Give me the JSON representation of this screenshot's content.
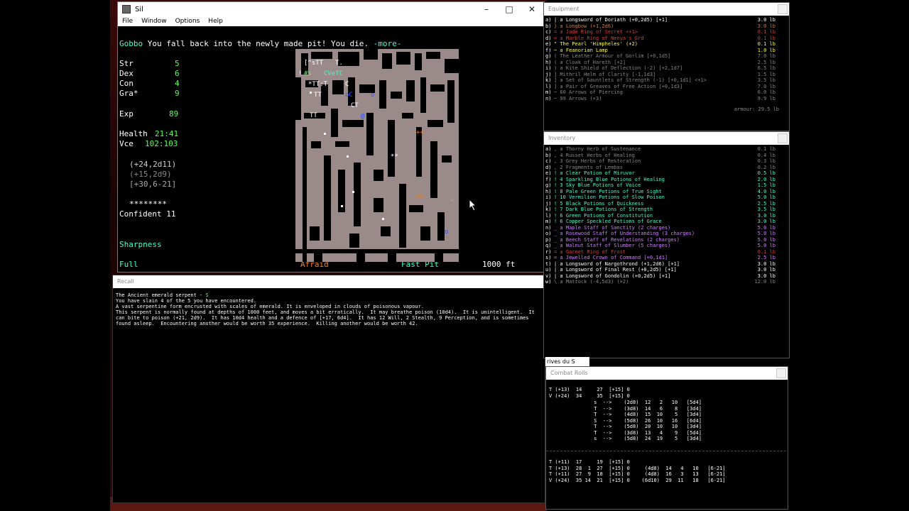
{
  "window": {
    "title": "Sil",
    "menu": [
      "File",
      "Window",
      "Options",
      "Help"
    ]
  },
  "message": {
    "text": "You fall back into the newly made pit! You die.",
    "more": "-more-"
  },
  "character": {
    "name": "Gobbo",
    "stats": [
      {
        "label": "Str",
        "value": "5"
      },
      {
        "label": "Dex",
        "value": "6"
      },
      {
        "label": "Con",
        "value": "4"
      },
      {
        "label": "Gra*",
        "value": "9"
      }
    ],
    "exp_label": "Exp",
    "exp_value": "89",
    "health_label": "Health",
    "health_value": "21:41",
    "voice_label": "Vce",
    "voice_value": "102:103",
    "melee1": "(+24,2d11)",
    "melee2": "(+15,2d9)",
    "armour": "[+30,6-21]",
    "stars": "********",
    "confidence": "Confident 11",
    "sharpness": "Sharpness",
    "status_full": "Full",
    "status_afraid": "Afraid",
    "status_fastpit": "Fast Pit",
    "depth": "1000 ft"
  },
  "equipment": {
    "title": "Equipment",
    "items": [
      {
        "slot": "a)",
        "text": "| a Longsword of Doriath (+0,2d5) [+1]",
        "weight": "3.0 lb",
        "color": "#ffffff"
      },
      {
        "slot": "b)",
        "text": "} a Longbow (+1,2d6)",
        "weight": "3.0 lb",
        "color": "#c08050"
      },
      {
        "slot": "c)",
        "text": "= a Jade Ring of Secret <+1>",
        "weight": "0.1 lb",
        "color": "#d04040"
      },
      {
        "slot": "d)",
        "text": "= a Marble Ring of Nenya's Grd",
        "weight": "0.1 lb",
        "color": "#d04040"
      },
      {
        "slot": "e)",
        "text": "\" The Pearl 'Himpheles' (+2)",
        "weight": "0.1 lb",
        "color": "#ffff40"
      },
      {
        "slot": "f)",
        "text": "~ a Feanorian Lamp",
        "weight": "1.0 lb",
        "color": "#ffff40"
      },
      {
        "slot": "g)",
        "text": "( The Leather Armour of Gorlim [+0,1d5]",
        "weight": "7.0 lb",
        "color": "#888888"
      },
      {
        "slot": "h)",
        "text": "( a Cloak of Hareth [+2]",
        "weight": "2.5 lb",
        "color": "#888888"
      },
      {
        "slot": "i)",
        "text": ") a Kite Shield of Deflection (-2) [+2,1d7]",
        "weight": "6.5 lb",
        "color": "#888888"
      },
      {
        "slot": "j)",
        "text": "] Mithril Helm of Clarity [-1,1d3]",
        "weight": "1.5 lb",
        "color": "#888888"
      },
      {
        "slot": "k)",
        "text": "] a Set of Gauntlets of Strength (-1) [+0,1d1] <+1>",
        "weight": "3.5 lb",
        "color": "#888888"
      },
      {
        "slot": "l)",
        "text": "] a Pair of Greaves of Free Action [+0,1d3]",
        "weight": "7.0 lb",
        "color": "#888888"
      },
      {
        "slot": "m)",
        "text": "~ 60 Arrows of Piercing",
        "weight": "6.0 lb",
        "color": "#888888"
      },
      {
        "slot": "n)",
        "text": "~ 99 Arrows (+3)",
        "weight": "9.9 lb",
        "color": "#888888"
      }
    ],
    "total": "armour: 29.5 lb"
  },
  "inventory": {
    "title": "Inventory",
    "items": [
      {
        "slot": "a)",
        "text": ", a Thorny Herb of Sustenance",
        "weight": "0.1 lb",
        "color": "#888888"
      },
      {
        "slot": "b)",
        "text": ", 4 Russet Herbs of Healing",
        "weight": "0.4 lb",
        "color": "#888888"
      },
      {
        "slot": "c)",
        "text": ", 3 Grey Herbs of Restoration",
        "weight": "0.3 lb",
        "color": "#888888"
      },
      {
        "slot": "d)",
        "text": ", 2 Fragments of Lembas",
        "weight": "0.2 lb",
        "color": "#888888"
      },
      {
        "slot": "e)",
        "text": "! a Clear Potion of Miruvor",
        "weight": "0.5 lb",
        "color": "#40ffd0"
      },
      {
        "slot": "f)",
        "text": "! 4 Sparkling Blue Potions of Healing",
        "weight": "2.0 lb",
        "color": "#40ffd0"
      },
      {
        "slot": "g)",
        "text": "! 3 Sky Blue Potions of Voice",
        "weight": "1.5 lb",
        "color": "#40ffd0"
      },
      {
        "slot": "h)",
        "text": "! 8 Pale Green Potions of True Sight",
        "weight": "4.0 lb",
        "color": "#40ffd0"
      },
      {
        "slot": "i)",
        "text": "! 10 Vermilion Potions of Slow Poison",
        "weight": "5.0 lb",
        "color": "#40ffd0"
      },
      {
        "slot": "j)",
        "text": "! 5 Black Potions of Quickness",
        "weight": "2.5 lb",
        "color": "#40ffd0"
      },
      {
        "slot": "k)",
        "text": "! 7 Dark Blue Potions of Strength",
        "weight": "3.5 lb",
        "color": "#40ffd0"
      },
      {
        "slot": "l)",
        "text": "! 6 Green Potions of Constitution",
        "weight": "3.0 lb",
        "color": "#40ffd0"
      },
      {
        "slot": "m)",
        "text": "! 6 Copper Speckled Potions of Grace",
        "weight": "3.0 lb",
        "color": "#40ffd0"
      },
      {
        "slot": "n)",
        "text": "_ a Maple Staff of Sanctity (2 charges)",
        "weight": "5.0 lb",
        "color": "#d080ff"
      },
      {
        "slot": "o)",
        "text": "_ a Rosewood Staff of Understanding (3 charges)",
        "weight": "5.0 lb",
        "color": "#d080ff"
      },
      {
        "slot": "p)",
        "text": "_ a Beech Staff of Revelations (2 charges)",
        "weight": "5.0 lb",
        "color": "#d080ff"
      },
      {
        "slot": "q)",
        "text": "_ a Walnut Staff of Slumber (5 charges)",
        "weight": "5.0 lb",
        "color": "#d080ff"
      },
      {
        "slot": "r)",
        "text": "= a Garnet Ring of Frost",
        "weight": "0.1 lb",
        "color": "#d04040"
      },
      {
        "slot": "s)",
        "text": "= a Jewelled Crown of Command [+0,1d1]",
        "weight": "2.5 lb",
        "color": "#d080ff"
      },
      {
        "slot": "t)",
        "text": "| a Longsword of Nargothrond (+1,2d6) [+1]",
        "weight": "3.0 lb",
        "color": "#ffffff"
      },
      {
        "slot": "u)",
        "text": "| a Longsword of Final Rest (+0,2d5) [+1]",
        "weight": "3.0 lb",
        "color": "#ffffff"
      },
      {
        "slot": "v)",
        "text": "| a Longsword of Gondolin (+0,2d5) [+1]",
        "weight": "3.0 lb",
        "color": "#ffffff"
      },
      {
        "slot": "w)",
        "text": "\\ a Mattock (-4,5d3) (+2)",
        "weight": "12.0 lb",
        "color": "#888888"
      }
    ]
  },
  "recall": {
    "title": "Recall",
    "heading": "The Ancient emerald serpent",
    "symbol": "S",
    "lines": [
      "You have slain 4 of the 5 you have encountered.",
      "A vast serpentine form encrusted with scales of emerald. It is enveloped in clouds of poisonous vapour.",
      "This serpent is normally found at depths of 1000 feet, and moves a bit erratically.  It may breathe poison (10d4).  It is unintelligent.  It",
      "can bite to poison (+21, 2d9).  It has 10d4 health and a defence of [+17, 6d4].  It has 12 Will, 2 Stealth, 9 Perception, and is sometimes",
      "found asleep.  Encountering another would be worth 35 experience.  Killing another would be worth 42."
    ]
  },
  "combat": {
    "title": "Combat Rolls",
    "tab_label": "rives du S",
    "rows_top": [
      "T (+13)  14     27  [+15] 0",
      "V (+24)  34     35  [+15] 0"
    ],
    "rows_mid": [
      "               s  -->    (2d8)  12   2   10   [5d4]",
      "               T  -->    (3d8)  14   6    8   [3d4]",
      "               T  -->    (4d8)  15  10    5   [3d4]",
      "               S  -->    (5d8)  26  10   16   [6d4]",
      "               T  -->    (5d8)  20  10   10   [3d4]",
      "               T  -->    (3d8)  13   4    9   [5d4]",
      "               s  -->    (5d8)  24  19    5   [3d4]"
    ],
    "rows_bottom": [
      "T (+11)  17     19  [+15] 0",
      "T (+13)  28  1  27  [+15] 0     (4d8)  14   4   10   [6-21]",
      "T (+11)  27  9  18  [+15] 0     (4d8)  16   3   13   [6-21]",
      "V (+24)  35 14  21  [+15] 0    (6d10)  29  11   18   [6-21]"
    ]
  }
}
